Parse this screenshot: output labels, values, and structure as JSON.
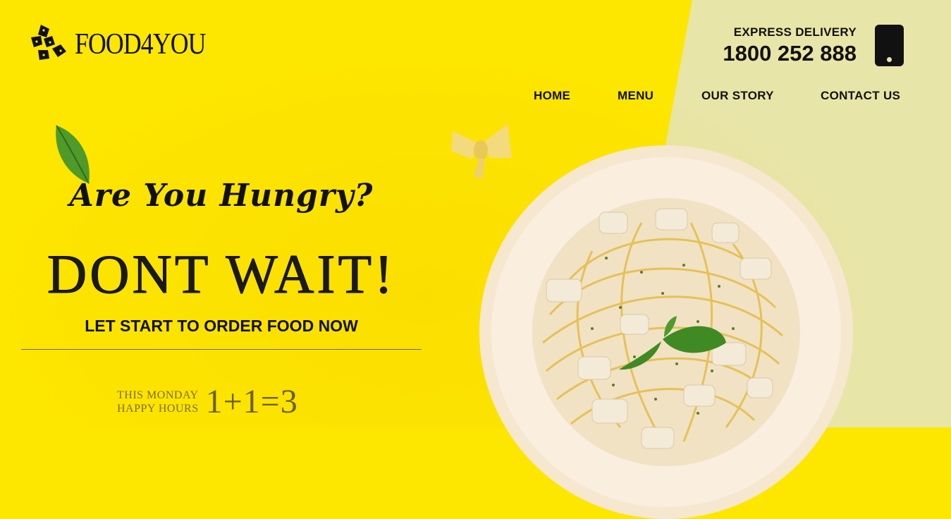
{
  "brand": {
    "name": "FOOD4YOU"
  },
  "contact": {
    "label": "EXPRESS DELIVERY",
    "phone": "1800 252 888",
    "icon": "phone-icon"
  },
  "nav": {
    "items": [
      "HOME",
      "MENU",
      "OUR STORY",
      "CONTACT US"
    ]
  },
  "hero": {
    "headline": "Are You Hungry?",
    "title": "DONT WAIT!",
    "tagline": "LET START TO ORDER FOOD NOW"
  },
  "promo": {
    "line1": "THIS MONDAY",
    "line2": "HAPPY HOURS",
    "offer": "1+1=3"
  },
  "colors": {
    "primary": "#fde600",
    "secondary": "#e8e5a8",
    "text": "#111111"
  }
}
